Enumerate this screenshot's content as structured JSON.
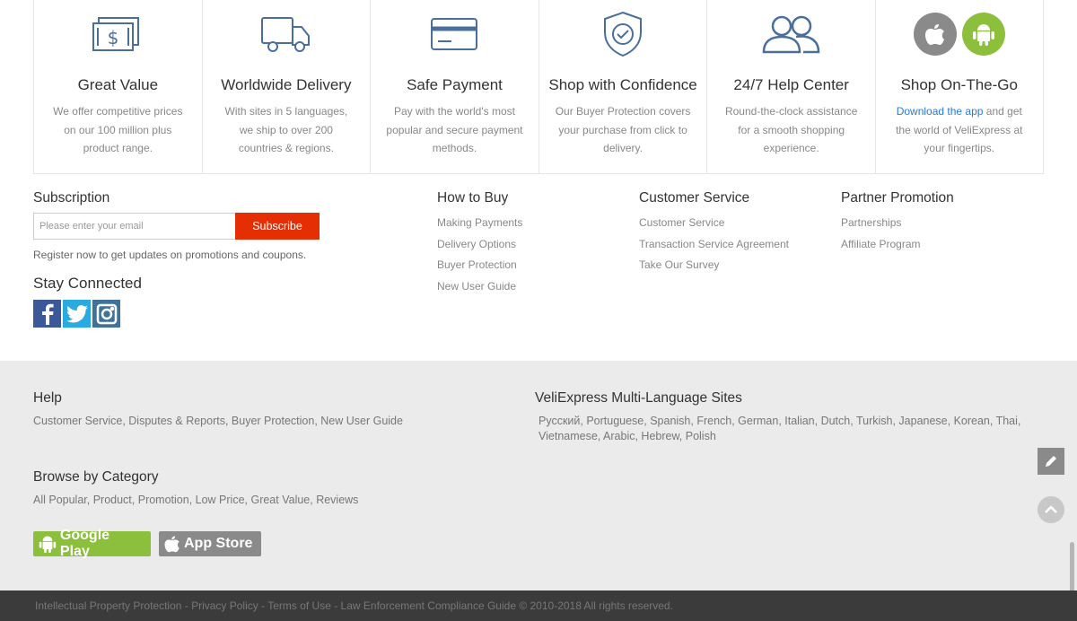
{
  "features": [
    {
      "icon": "money-icon",
      "title": "Great Value",
      "desc": "We offer competitive prices on our 100 million plus product range."
    },
    {
      "icon": "truck-icon",
      "title": "Worldwide Delivery",
      "desc": "With sites in 5 languages, we ship to over 200 countries & regions."
    },
    {
      "icon": "credit-card-icon",
      "title": "Safe Payment",
      "desc": "Pay with the world's most popular and secure payment methods."
    },
    {
      "icon": "shield-check-icon",
      "title": "Shop with Confidence",
      "desc": "Our Buyer Protection covers your purchase from click to delivery."
    },
    {
      "icon": "people-icon",
      "title": "24/7 Help Center",
      "desc": "Round-the-clock assistance for a smooth shopping experience."
    },
    {
      "icon": "apple-android-icon",
      "title": "Shop On-The-Go",
      "desc_link": "Download the app",
      "desc_rest": " and get the world of VeliExpress at your fingertips."
    }
  ],
  "subscription": {
    "title": "Subscription",
    "placeholder": "Please enter your email",
    "button": "Subscribe",
    "note": "Register now to get updates on promotions and coupons."
  },
  "stay_connected": {
    "title": "Stay Connected",
    "networks": [
      "facebook-icon",
      "twitter-icon",
      "instagram-icon"
    ]
  },
  "how_to_buy": {
    "title": "How to Buy",
    "links": [
      "Making Payments",
      "Delivery Options",
      "Buyer Protection",
      "New User Guide"
    ]
  },
  "customer_service": {
    "title": "Customer Service",
    "links": [
      "Customer Service",
      "Transaction Service Agreement",
      "Take Our Survey"
    ]
  },
  "partner_promotion": {
    "title": "Partner Promotion",
    "links": [
      "Partnerships",
      "Affiliate Program"
    ]
  },
  "help": {
    "title": "Help",
    "text": "Customer Service, Disputes & Reports, Buyer Protection, New User Guide"
  },
  "multi_language": {
    "title": "VeliExpress Multi-Language Sites",
    "text": "Русский, Portuguese, Spanish, French, German, Italian, Dutch, Turkish, Japanese, Korean, Thai, Vietnamese, Arabic, Hebrew, Polish"
  },
  "browse": {
    "title": "Browse by Category",
    "text": "All Popular, Product, Promotion, Low Price, Great Value, Reviews"
  },
  "stores": {
    "google_play": "Google Play",
    "app_store": "App Store"
  },
  "bottom_bar": {
    "text": "Intellectual Property Protection - Privacy Policy - Terms of Use - Law Enforcement Compliance Guide © 2010-2018 All rights reserved."
  },
  "colors": {
    "accent_red": "#e62e04",
    "icon_blue": "#4a6f9c",
    "link_blue": "#2c7bd3",
    "android_green": "#8cc03c"
  }
}
